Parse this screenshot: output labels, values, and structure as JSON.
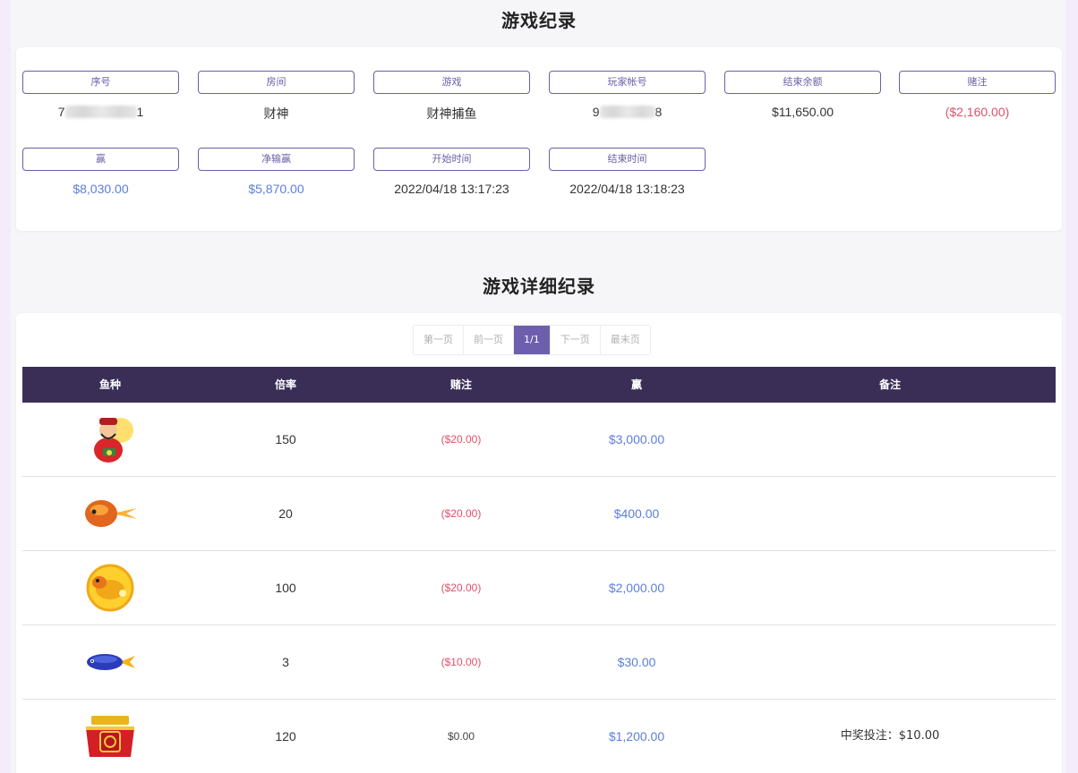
{
  "record_title": "游戏纪录",
  "detail_title": "游戏详细纪录",
  "fields": [
    {
      "label": "序号",
      "value_prefix": "7",
      "value_suffix": "1",
      "masked": true,
      "color": "default"
    },
    {
      "label": "房间",
      "value": "财神",
      "color": "default"
    },
    {
      "label": "游戏",
      "value": "财神捕鱼",
      "color": "default"
    },
    {
      "label": "玩家帐号",
      "value_prefix": "9",
      "value_suffix": "8",
      "masked": true,
      "color": "default"
    },
    {
      "label": "结束余额",
      "value": "$11,650.00",
      "color": "default"
    },
    {
      "label": "赌注",
      "value": "($2,160.00)",
      "color": "#e0506a"
    },
    {
      "label": "赢",
      "value": "$8,030.00",
      "color": "#5b7fdc"
    },
    {
      "label": "净输赢",
      "value": "$5,870.00",
      "color": "#5b7fdc"
    },
    {
      "label": "开始时间",
      "value": "2022/04/18 13:17:23",
      "color": "default"
    },
    {
      "label": "结束时间",
      "value": "2022/04/18 13:18:23",
      "color": "default"
    }
  ],
  "pager": {
    "first": "第一页",
    "prev": "前一页",
    "current": "1/1",
    "next": "下一页",
    "last": "最末页"
  },
  "table": {
    "headers": [
      "鱼种",
      "倍率",
      "赌注",
      "赢",
      "备注"
    ],
    "rows": [
      {
        "fish_icon": "god-of-wealth-icon",
        "multiplier": "150",
        "bet": "($20.00)",
        "win": "$3,000.00",
        "note": ""
      },
      {
        "fish_icon": "fire-fish-icon",
        "multiplier": "20",
        "bet": "($20.00)",
        "win": "$400.00",
        "note": ""
      },
      {
        "fish_icon": "golden-toad-icon",
        "multiplier": "100",
        "bet": "($20.00)",
        "win": "$2,000.00",
        "note": ""
      },
      {
        "fish_icon": "blue-fish-icon",
        "multiplier": "3",
        "bet": "($10.00)",
        "win": "$30.00",
        "note": ""
      },
      {
        "fish_icon": "lucky-box-icon",
        "multiplier": "120",
        "bet": "$0.00",
        "win": "$1,200.00",
        "note": "中奖投注：$10.00"
      }
    ]
  },
  "colors": {
    "accent": "#6e5fae",
    "header_bg": "#3a2e57",
    "negative": "#e0506a",
    "positive": "#5b7fdc"
  }
}
